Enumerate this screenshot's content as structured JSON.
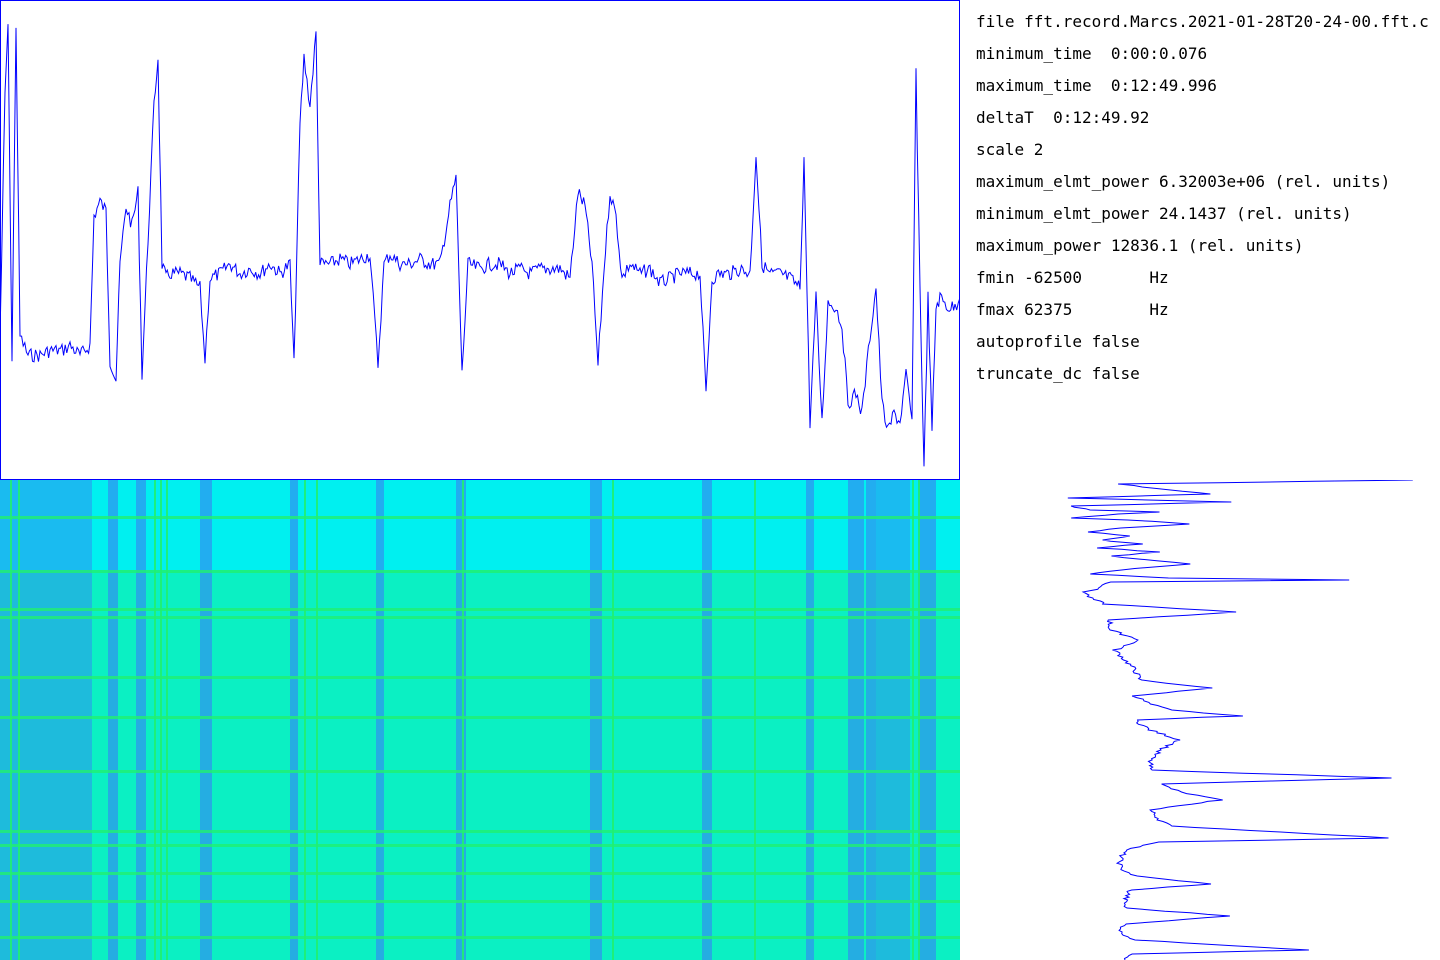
{
  "info": {
    "file": "file fft.record.Marcs.2021-01-28T20-24-00.fft.c",
    "minimum_time": "minimum_time  0:00:0.076",
    "maximum_time": "maximum_time  0:12:49.996",
    "deltaT": "deltaT  0:12:49.92",
    "scale": "scale 2",
    "maximum_elmt_power": "maximum_elmt_power 6.32003e+06 (rel. units)",
    "minimum_elmt_power": "minimum_elmt_power 24.1437 (rel. units)",
    "maximum_power": "maximum_power 12836.1 (rel. units)",
    "fmin": "fmin -62500       Hz",
    "fmax": "fmax 62375        Hz",
    "autoprofile": "autoprofile false",
    "truncate_dc": "truncate_dc false"
  },
  "colors": {
    "trace": "#0000ff",
    "frame": "#0000ff",
    "background": "#ffffff",
    "spectrogram_base": "#00f0f0",
    "spectrogram_low": "#3090f0",
    "spectrogram_high": "#20f070"
  },
  "chart_data": [
    {
      "type": "line",
      "description_panel": "time-power-profile",
      "x_range": [
        0,
        960
      ],
      "y_range": [
        0,
        1
      ],
      "series": [
        {
          "points": [
            [
              0,
              0.7
            ],
            [
              5,
              0.2
            ],
            [
              8,
              0.05
            ],
            [
              12,
              0.75
            ],
            [
              16,
              0.05
            ],
            [
              20,
              0.7
            ],
            [
              28,
              0.74
            ],
            [
              40,
              0.74
            ],
            [
              50,
              0.73
            ],
            [
              62,
              0.73
            ],
            [
              70,
              0.72
            ],
            [
              80,
              0.74
            ],
            [
              90,
              0.72
            ],
            [
              94,
              0.45
            ],
            [
              100,
              0.42
            ],
            [
              106,
              0.44
            ],
            [
              110,
              0.75
            ],
            [
              116,
              0.79
            ],
            [
              120,
              0.55
            ],
            [
              126,
              0.43
            ],
            [
              132,
              0.47
            ],
            [
              138,
              0.4
            ],
            [
              142,
              0.78
            ],
            [
              148,
              0.5
            ],
            [
              154,
              0.22
            ],
            [
              158,
              0.12
            ],
            [
              162,
              0.55
            ],
            [
              166,
              0.58
            ],
            [
              170,
              0.57
            ],
            [
              180,
              0.57
            ],
            [
              190,
              0.58
            ],
            [
              200,
              0.6
            ],
            [
              205,
              0.75
            ],
            [
              210,
              0.58
            ],
            [
              220,
              0.57
            ],
            [
              230,
              0.55
            ],
            [
              240,
              0.57
            ],
            [
              250,
              0.56
            ],
            [
              260,
              0.57
            ],
            [
              270,
              0.55
            ],
            [
              280,
              0.57
            ],
            [
              290,
              0.55
            ],
            [
              294,
              0.76
            ],
            [
              300,
              0.26
            ],
            [
              304,
              0.12
            ],
            [
              310,
              0.22
            ],
            [
              316,
              0.07
            ],
            [
              320,
              0.55
            ],
            [
              330,
              0.55
            ],
            [
              340,
              0.54
            ],
            [
              350,
              0.55
            ],
            [
              360,
              0.54
            ],
            [
              370,
              0.53
            ],
            [
              378,
              0.76
            ],
            [
              384,
              0.55
            ],
            [
              390,
              0.53
            ],
            [
              400,
              0.55
            ],
            [
              410,
              0.55
            ],
            [
              420,
              0.54
            ],
            [
              430,
              0.55
            ],
            [
              440,
              0.55
            ],
            [
              450,
              0.43
            ],
            [
              456,
              0.37
            ],
            [
              462,
              0.78
            ],
            [
              468,
              0.55
            ],
            [
              480,
              0.56
            ],
            [
              490,
              0.55
            ],
            [
              500,
              0.55
            ],
            [
              510,
              0.57
            ],
            [
              520,
              0.56
            ],
            [
              530,
              0.57
            ],
            [
              540,
              0.56
            ],
            [
              550,
              0.56
            ],
            [
              560,
              0.56
            ],
            [
              570,
              0.58
            ],
            [
              578,
              0.4
            ],
            [
              585,
              0.43
            ],
            [
              592,
              0.55
            ],
            [
              598,
              0.76
            ],
            [
              604,
              0.56
            ],
            [
              610,
              0.4
            ],
            [
              616,
              0.45
            ],
            [
              622,
              0.58
            ],
            [
              630,
              0.55
            ],
            [
              640,
              0.57
            ],
            [
              650,
              0.56
            ],
            [
              660,
              0.59
            ],
            [
              670,
              0.58
            ],
            [
              680,
              0.57
            ],
            [
              690,
              0.57
            ],
            [
              700,
              0.57
            ],
            [
              706,
              0.82
            ],
            [
              712,
              0.58
            ],
            [
              720,
              0.57
            ],
            [
              730,
              0.57
            ],
            [
              740,
              0.56
            ],
            [
              750,
              0.57
            ],
            [
              756,
              0.32
            ],
            [
              762,
              0.55
            ],
            [
              770,
              0.57
            ],
            [
              780,
              0.57
            ],
            [
              790,
              0.58
            ],
            [
              800,
              0.6
            ],
            [
              804,
              0.33
            ],
            [
              810,
              0.88
            ],
            [
              816,
              0.62
            ],
            [
              822,
              0.88
            ],
            [
              828,
              0.63
            ],
            [
              836,
              0.64
            ],
            [
              842,
              0.68
            ],
            [
              848,
              0.84
            ],
            [
              856,
              0.82
            ],
            [
              862,
              0.86
            ],
            [
              870,
              0.7
            ],
            [
              876,
              0.6
            ],
            [
              882,
              0.84
            ],
            [
              888,
              0.9
            ],
            [
              894,
              0.86
            ],
            [
              900,
              0.88
            ],
            [
              906,
              0.78
            ],
            [
              912,
              0.88
            ],
            [
              916,
              0.15
            ],
            [
              920,
              0.6
            ],
            [
              924,
              0.98
            ],
            [
              928,
              0.62
            ],
            [
              932,
              0.9
            ],
            [
              936,
              0.64
            ],
            [
              940,
              0.62
            ],
            [
              948,
              0.64
            ],
            [
              955,
              0.64
            ],
            [
              960,
              0.62
            ]
          ]
        }
      ]
    },
    {
      "type": "heatmap",
      "description_panel": "spectrogram",
      "x_range": [
        0,
        960
      ],
      "y_range": [
        0,
        480
      ],
      "low_columns": [
        [
          0,
          92
        ],
        [
          108,
          118
        ],
        [
          136,
          146
        ],
        [
          200,
          212
        ],
        [
          290,
          298
        ],
        [
          376,
          384
        ],
        [
          456,
          466
        ],
        [
          590,
          602
        ],
        [
          702,
          712
        ],
        [
          806,
          814
        ],
        [
          848,
          864
        ],
        [
          866,
          876
        ],
        [
          876,
          910
        ],
        [
          918,
          936
        ]
      ],
      "hot_columns": [
        10,
        18,
        154,
        160,
        166,
        304,
        316,
        462,
        612,
        754,
        912,
        918
      ],
      "hot_rows": [
        36,
        90,
        128,
        136,
        196,
        236,
        290,
        350,
        364,
        392,
        420,
        456
      ]
    },
    {
      "type": "line",
      "description_panel": "frequency-profile",
      "x_range": [
        0,
        480
      ],
      "y_range": [
        0,
        480
      ],
      "series": [
        {
          "points": [
            [
              450,
              0
            ],
            [
              160,
              4
            ],
            [
              210,
              10
            ],
            [
              250,
              14
            ],
            [
              110,
              18
            ],
            [
              270,
              22
            ],
            [
              110,
              26
            ],
            [
              130,
              30
            ],
            [
              200,
              32
            ],
            [
              160,
              34
            ],
            [
              110,
              38
            ],
            [
              170,
              40
            ],
            [
              230,
              44
            ],
            [
              160,
              48
            ],
            [
              130,
              52
            ],
            [
              170,
              56
            ],
            [
              140,
              60
            ],
            [
              180,
              64
            ],
            [
              140,
              68
            ],
            [
              200,
              72
            ],
            [
              150,
              76
            ],
            [
              230,
              84
            ],
            [
              160,
              90
            ],
            [
              130,
              94
            ],
            [
              210,
              98
            ],
            [
              390,
              100
            ],
            [
              150,
              102
            ],
            [
              140,
              108
            ],
            [
              125,
              112
            ],
            [
              130,
              118
            ],
            [
              145,
              124
            ],
            [
              275,
              132
            ],
            [
              150,
              140
            ],
            [
              150,
              150
            ],
            [
              180,
              160
            ],
            [
              155,
              170
            ],
            [
              165,
              180
            ],
            [
              175,
              190
            ],
            [
              180,
              200
            ],
            [
              250,
              208
            ],
            [
              175,
              216
            ],
            [
              190,
              224
            ],
            [
              210,
              230
            ],
            [
              280,
              236
            ],
            [
              175,
              240
            ],
            [
              190,
              250
            ],
            [
              220,
              260
            ],
            [
              200,
              270
            ],
            [
              190,
              280
            ],
            [
              190,
              290
            ],
            [
              430,
              298
            ],
            [
              200,
              304
            ],
            [
              220,
              312
            ],
            [
              260,
              320
            ],
            [
              190,
              330
            ],
            [
              200,
              340
            ],
            [
              210,
              346
            ],
            [
              430,
              358
            ],
            [
              200,
              362
            ],
            [
              165,
              370
            ],
            [
              160,
              380
            ],
            [
              160,
              388
            ],
            [
              175,
              396
            ],
            [
              250,
              404
            ],
            [
              170,
              410
            ],
            [
              165,
              420
            ],
            [
              165,
              428
            ],
            [
              270,
              436
            ],
            [
              165,
              444
            ],
            [
              160,
              452
            ],
            [
              175,
              460
            ],
            [
              350,
              470
            ],
            [
              170,
              474
            ],
            [
              165,
              480
            ]
          ]
        }
      ]
    }
  ]
}
